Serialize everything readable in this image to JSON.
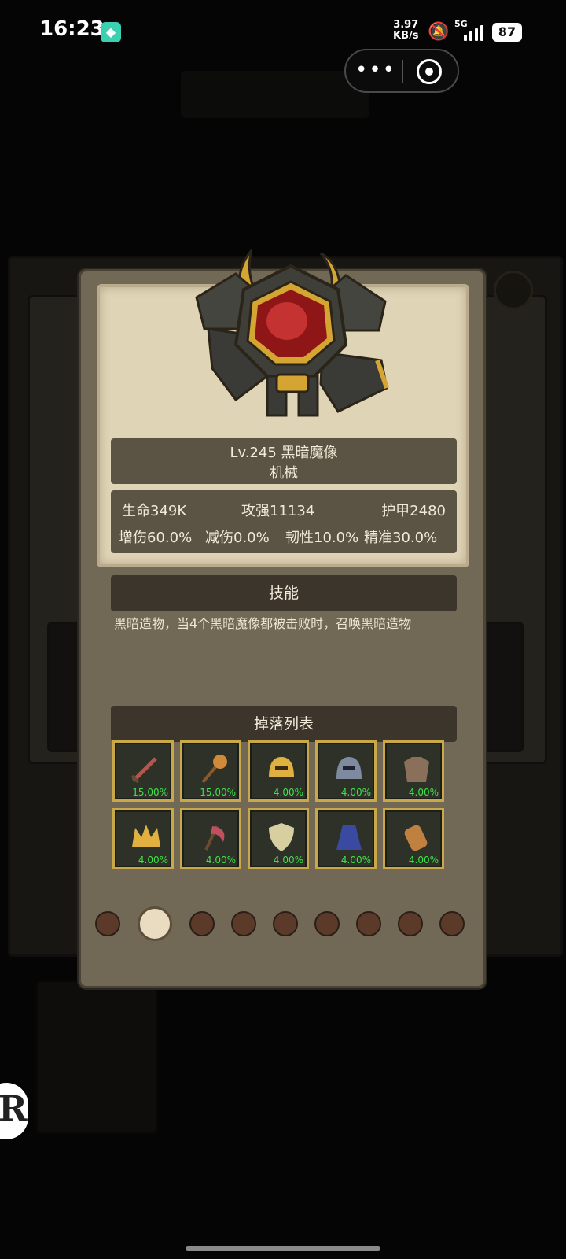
{
  "status_bar": {
    "time": "16:23",
    "net_speed_value": "3.97",
    "net_speed_unit": "KB/s",
    "signal": "5G",
    "battery": "87"
  },
  "capsule": {
    "more_icon": "more-dots-icon",
    "close_icon": "target-circle-icon"
  },
  "monster": {
    "name_line": "Lv.245 黑暗魔像",
    "type": "机械",
    "stats": {
      "hp": "生命349K",
      "atk": "攻强11134",
      "armor": "护甲2480",
      "dmg_up": "增伤60.0%",
      "dmg_down": "减伤0.0%",
      "toughness": "韧性10.0%",
      "precision": "精准30.0%"
    }
  },
  "skill": {
    "title": "技能",
    "description": "黑暗造物，当4个黑暗魔像都被击败时，召唤黑暗造物"
  },
  "drops": {
    "title": "掉落列表",
    "items": [
      {
        "icon": "sword-icon",
        "rate": "15.00%",
        "color": "#b8554a"
      },
      {
        "icon": "mace-icon",
        "rate": "15.00%",
        "color": "#d08a3a"
      },
      {
        "icon": "gold-helmet-icon",
        "rate": "4.00%",
        "color": "#e0b040"
      },
      {
        "icon": "dark-helmet-icon",
        "rate": "4.00%",
        "color": "#7d8aa0"
      },
      {
        "icon": "armor-icon",
        "rate": "4.00%",
        "color": "#8a6f5a"
      },
      {
        "icon": "crown-icon",
        "rate": "4.00%",
        "color": "#e0b040"
      },
      {
        "icon": "axe-icon",
        "rate": "4.00%",
        "color": "#c05060"
      },
      {
        "icon": "shield-icon",
        "rate": "4.00%",
        "color": "#d8cfa0"
      },
      {
        "icon": "cloak-icon",
        "rate": "4.00%",
        "color": "#3a4aa0"
      },
      {
        "icon": "bracer-icon",
        "rate": "4.00%",
        "color": "#c08040"
      }
    ]
  },
  "pagination": {
    "total": 9,
    "active_index": 1
  },
  "colors": {
    "accent_green": "#3fe24a",
    "panel": "#716856",
    "parchment": "#e0d4b6"
  }
}
